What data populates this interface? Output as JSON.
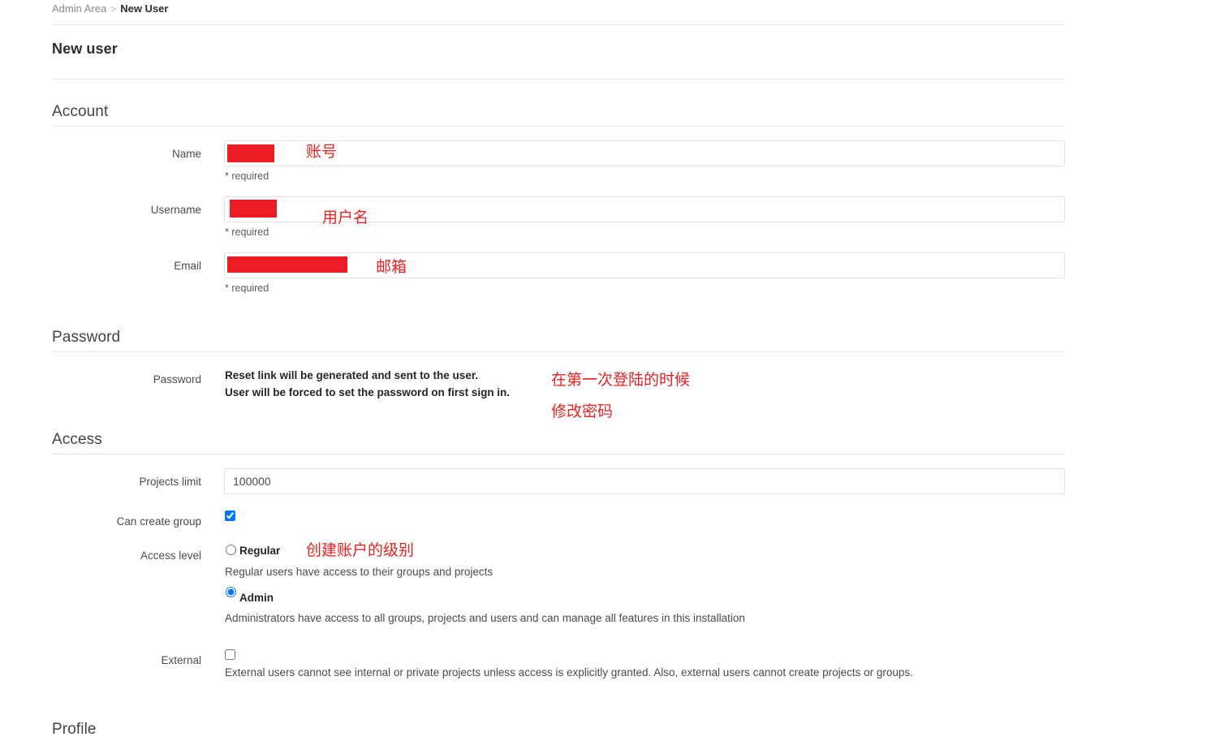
{
  "breadcrumb": {
    "root": "Admin Area",
    "separator": ">",
    "current": "New User"
  },
  "page_title": "New user",
  "sections": {
    "account": {
      "heading": "Account",
      "fields": {
        "name": {
          "label": "Name",
          "value": "",
          "help": "* required",
          "annotation": "账号"
        },
        "username": {
          "label": "Username",
          "value": "",
          "help": "* required",
          "annotation": "用户名"
        },
        "email": {
          "label": "Email",
          "value": "",
          "help": "* required",
          "annotation": "邮箱"
        }
      }
    },
    "password": {
      "heading": "Password",
      "label": "Password",
      "info_line1": "Reset link will be generated and sent to the user.",
      "info_line2": "User will be forced to set the password on first sign in.",
      "annotation_line1": "在第一次登陆的时候",
      "annotation_line2": "修改密码"
    },
    "access": {
      "heading": "Access",
      "projects_limit": {
        "label": "Projects limit",
        "value": "100000"
      },
      "can_create_group": {
        "label": "Can create group",
        "checked": true
      },
      "access_level": {
        "label": "Access level",
        "annotation": "创建账户的级别",
        "options": [
          {
            "label": "Regular",
            "description": "Regular users have access to their groups and projects",
            "selected": false
          },
          {
            "label": "Admin",
            "description": "Administrators have access to all groups, projects and users and can manage all features in this installation",
            "selected": true
          }
        ]
      },
      "external": {
        "label": "External",
        "checked": false,
        "description": "External users cannot see internal or private projects unless access is explicitly granted. Also, external users cannot create projects or groups."
      }
    },
    "profile": {
      "heading": "Profile"
    }
  },
  "colors": {
    "annotation_red": "#ee2222",
    "redaction_red": "#ec1c24",
    "rule_gray": "#e5e5e5"
  }
}
